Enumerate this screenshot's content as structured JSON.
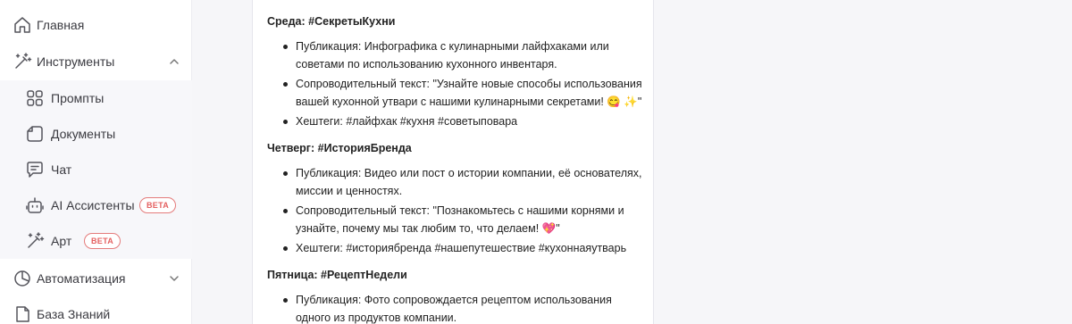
{
  "sidebar": {
    "home": "Главная",
    "tools": "Инструменты",
    "prompts": "Промпты",
    "documents": "Документы",
    "chat": "Чат",
    "ai_assistants": "AI Ассистенты",
    "art": "Арт",
    "beta": "BETA",
    "automation": "Автоматизация",
    "knowledge_base": "База Знаний"
  },
  "content": {
    "days": [
      {
        "title": "Среда: #СекретыКухни",
        "points": [
          "Публикация: Инфографика с кулинарными лайфхаками или советами по использованию кухонного инвентаря.",
          "Сопроводительный текст: \"Узнайте новые способы использования вашей кухонной утвари с нашими кулинарными секретами! 😋 ✨\"",
          "Хештеги: #лайфхак #кухня #советыповара"
        ]
      },
      {
        "title": "Четверг: #ИсторияБренда",
        "points": [
          "Публикация: Видео или пост о истории компании, её основателях, миссии и ценностях.",
          "Сопроводительный текст: \"Познакомьтесь с нашими корнями и узнайте, почему мы так любим то, что делаем! 💖\"",
          "Хештеги: #историябренда #нашепутешествие #кухоннаяутварь"
        ]
      },
      {
        "title": "Пятница: #РецептНедели",
        "points": [
          "Публикация: Фото сопровождается рецептом использования одного из продуктов компании."
        ]
      }
    ]
  }
}
